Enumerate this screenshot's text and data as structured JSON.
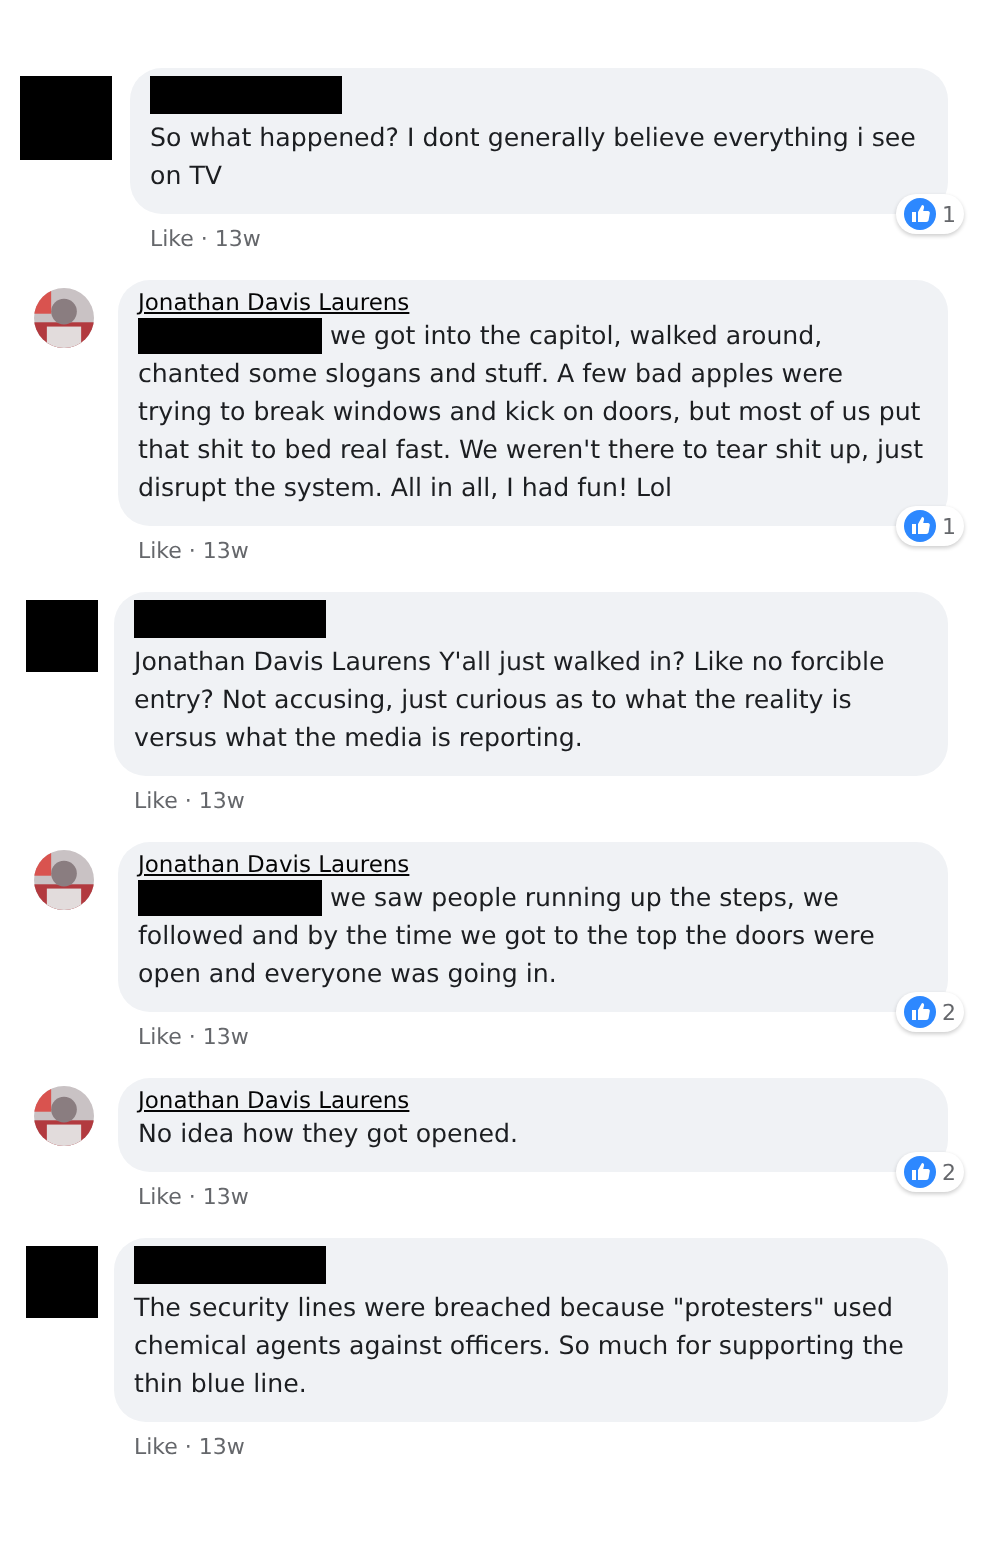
{
  "comments": [
    {
      "author": {
        "kind": "redacted"
      },
      "text": "So what happened? I dont generally believe everything i see on TV",
      "reactions": "1",
      "meta": "Like · 13w",
      "children": [
        {
          "author": {
            "name": "Jonathan Davis Laurens"
          },
          "mention_redacted": true,
          "text": "we got into the capitol, walked around, chanted some slogans and stuff. A few bad apples were trying to break windows and kick on doors, but most of us put that shit to bed real fast. We weren't there to tear shit up, just disrupt the system. All in all, I had fun! Lol",
          "reactions": "1",
          "meta": "Like · 13w"
        },
        {
          "author": {
            "kind": "redacted"
          },
          "mention_redacted": false,
          "text": "Jonathan Davis Laurens Y'all just walked in? Like no forcible entry? Not accusing, just curious as to what the reality is versus what the media is reporting.",
          "meta": "Like · 13w"
        },
        {
          "author": {
            "name": "Jonathan Davis Laurens"
          },
          "mention_redacted": true,
          "text": "we saw people running up the steps, we followed and by the time we got to the top the doors were open and everyone was going in.",
          "reactions": "2",
          "meta": "Like · 13w"
        },
        {
          "author": {
            "name": "Jonathan Davis Laurens"
          },
          "mention_redacted": false,
          "text": "No idea how they got opened.",
          "reactions": "2",
          "meta": "Like · 13w"
        },
        {
          "author": {
            "kind": "redacted"
          },
          "mention_redacted": false,
          "text": "The security lines were breached because \"protesters\" used chemical agents against officers. So much for supporting the thin blue line.",
          "meta": "Like · 13w"
        }
      ]
    }
  ]
}
